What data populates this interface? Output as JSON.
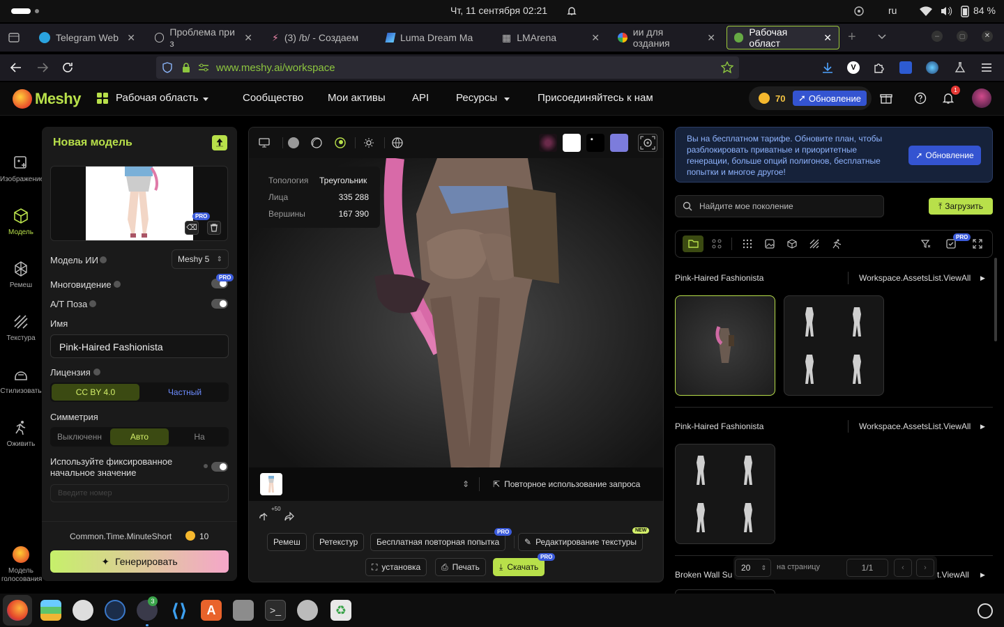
{
  "system": {
    "datetime": "Чт, 11 сентября  02:21",
    "lang": "ru",
    "battery": "84 %"
  },
  "tabs": [
    {
      "label": "Telegram Web",
      "icon": "telegram-icon"
    },
    {
      "label": "Проблема при з",
      "icon": "info-icon"
    },
    {
      "label": "(3) /b/ - Создаем",
      "icon": "sparkle-icon"
    },
    {
      "label": "Luma Dream Ma",
      "icon": "luma-icon"
    },
    {
      "label": "LMArena",
      "icon": "grid-icon"
    },
    {
      "label": "ии для оздания",
      "icon": "google-icon"
    },
    {
      "label": "Рабочая област",
      "icon": "meshy-icon",
      "active": true
    }
  ],
  "browser": {
    "url_domain": "www.meshy.ai",
    "url_path": "/workspace"
  },
  "header": {
    "logo": "Meshy",
    "workspace": "Рабочая область",
    "nav": [
      "Сообщество",
      "Мои активы",
      "API",
      "Ресурсы",
      "Присоединяйтесь к нам"
    ],
    "credits": "70",
    "upgrade": "Обновление",
    "notif_count": "1"
  },
  "rail": [
    {
      "label": "Изображение",
      "icon": "image-ai-icon"
    },
    {
      "label": "Модель",
      "icon": "cube-icon",
      "active": true
    },
    {
      "label": "Ремеш",
      "icon": "remesh-icon"
    },
    {
      "label": "Текстура",
      "icon": "texture-icon"
    },
    {
      "label": "Стилизовать",
      "icon": "stylize-icon"
    },
    {
      "label": "Оживить",
      "icon": "animate-icon"
    },
    {
      "label": "Модель голосования",
      "icon": "vote-icon"
    }
  ],
  "panel": {
    "title": "Новая модель",
    "ai_model_label": "Модель ИИ",
    "ai_model_value": "Meshy 5",
    "multiview": "Многовидение",
    "atpose": "A/T Поза",
    "name_label": "Имя",
    "name_value": "Pink-Haired Fashionista",
    "license_label": "Лицензия",
    "license_opts": [
      "CC BY 4.0",
      "Частный"
    ],
    "symmetry_label": "Симметрия",
    "symmetry_opts": [
      "Выключенн",
      "Авто",
      "На"
    ],
    "seed_label": "Используйте фиксированное начальное значение",
    "seed_placeholder": "Введите номер",
    "time": "Common.Time.MinuteShort",
    "cost": "10",
    "generate": "Генерировать",
    "pro": "PRO"
  },
  "viewer": {
    "stats": [
      {
        "k": "Топология",
        "v": "Треугольник"
      },
      {
        "k": "Лица",
        "v": "335 288"
      },
      {
        "k": "Вершины",
        "v": "167 390"
      }
    ],
    "reuse": "Повторное использование запроса",
    "plus50": "+50",
    "actions_row1": [
      "Ремеш",
      "Ретекстур",
      "Бесплатная повторная попытка",
      "Редактирование текстуры"
    ],
    "actions_row2": [
      "установка",
      "Печать",
      "Скачать"
    ],
    "new": "NEW"
  },
  "right": {
    "banner": "Вы на бесплатном тарифе. Обновите план, чтобы разблокировать приватные и приоритетные генерации, больше опций полигонов, бесплатные попытки и многое другое!",
    "banner_btn": "Обновление",
    "search_placeholder": "Найдите мое поколение",
    "upload": "Загрузить",
    "groups": [
      {
        "title": "Pink-Haired Fashionista",
        "link": "Workspace.AssetsList.ViewAll"
      },
      {
        "title": "Pink-Haired Fashionista",
        "link": "Workspace.AssetsList.ViewAll"
      },
      {
        "title": "Broken Wall Su",
        "link": "st.ViewAll"
      }
    ],
    "per_page": "20",
    "per_page_label": "на страницу",
    "page": "1/1"
  },
  "dock": {
    "badge": "3"
  }
}
